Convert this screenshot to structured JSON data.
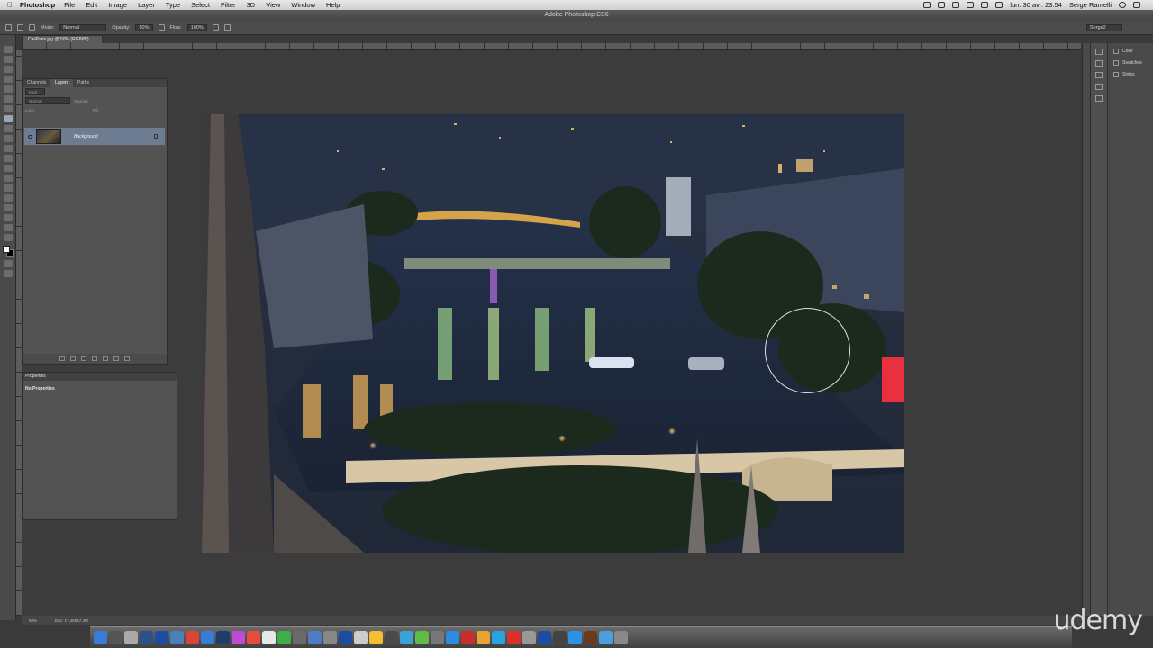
{
  "menubar": {
    "app": "Photoshop",
    "items": [
      "File",
      "Edit",
      "Image",
      "Layer",
      "Type",
      "Select",
      "Filter",
      "3D",
      "View",
      "Window",
      "Help"
    ],
    "datetime": "lun. 30 avr.  23:54",
    "user": "Serge Ramelli"
  },
  "titlebar": {
    "title": "Adobe Photoshop CS6"
  },
  "options": {
    "mode_label": "Mode:",
    "mode_value": "Normal",
    "opacity_label": "Opacity:",
    "opacity_value": "50%",
    "flow_label": "Flow:",
    "flow_value": "100%",
    "workspace": "Serge2"
  },
  "document": {
    "tab_title": "CielParis.jpg @ 50% (RGB/8*)",
    "zoom": "50%",
    "doc_size": "Doc: 17,4M/17,4M"
  },
  "layers_panel": {
    "tabs": [
      "Channels",
      "Layers",
      "Paths"
    ],
    "kind_label": "Kind",
    "blend_mode": "Normal",
    "opacity_label": "Opacity:",
    "lock_label": "Lock:",
    "fill_label": "Fill:",
    "layer_name": "Background"
  },
  "properties_panel": {
    "title": "Properties",
    "body": "No Properties"
  },
  "right_dock": {
    "items": [
      "Color",
      "Swatches",
      "Styles"
    ]
  },
  "watermark": "udemy",
  "colors": {
    "accent_layer": "#6d7c91",
    "panel_bg": "#535353",
    "canvas_bg": "#3c3c3c"
  },
  "icons": [
    "apple-icon",
    "wifi-icon",
    "battery-icon",
    "volume-icon",
    "bluetooth-icon",
    "spotlight-icon",
    "brush-tool-icon",
    "eye-icon",
    "lock-icon"
  ]
}
